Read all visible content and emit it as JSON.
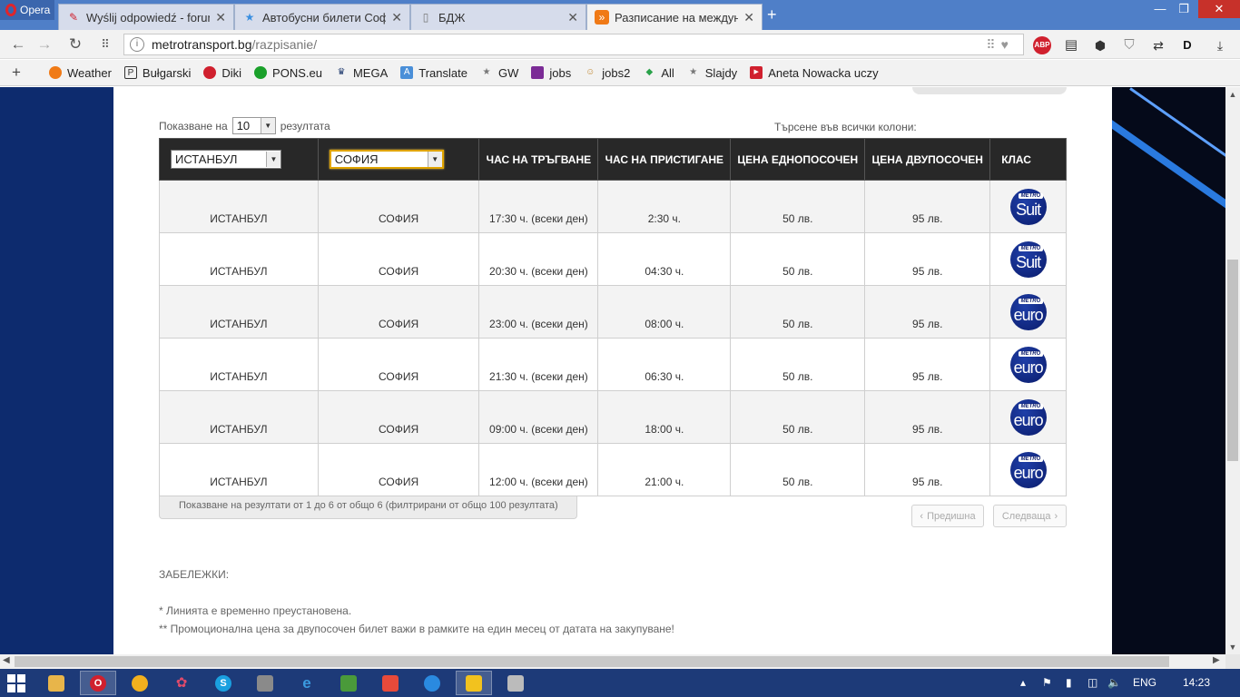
{
  "browser": {
    "app_name": "Opera",
    "tabs": [
      {
        "title": "Wyślij odpowiedź - forum",
        "icon": "pen-icon",
        "active": false
      },
      {
        "title": "Автобусни билети Софи",
        "icon": "star-badge-icon",
        "active": false
      },
      {
        "title": "БДЖ",
        "icon": "document-icon",
        "active": false
      },
      {
        "title": "Разписание на междунар",
        "icon": "orange-site-icon",
        "active": true
      }
    ],
    "new_tab": "+",
    "url_host": "metrotransport.bg",
    "url_path": "/razpisanie/",
    "extensions": {
      "adblock": "ABP"
    }
  },
  "bookmarks": [
    {
      "label": "Weather",
      "icon": "weather-icon",
      "color": "#f07a16"
    },
    {
      "label": "Bułgarski",
      "icon": "ip-icon",
      "color": "#333333"
    },
    {
      "label": "Diki",
      "icon": "diki-icon",
      "color": "#d0202e"
    },
    {
      "label": "PONS.eu",
      "icon": "pons-icon",
      "color": "#1aa02a"
    },
    {
      "label": "MEGA",
      "icon": "crown-icon",
      "color": "#1f3a6e"
    },
    {
      "label": "Translate",
      "icon": "translate-icon",
      "color": "#4a8fd8"
    },
    {
      "label": "GW",
      "icon": "star-icon",
      "color": "#777777"
    },
    {
      "label": "jobs",
      "icon": "square-icon",
      "color": "#7b2c96"
    },
    {
      "label": "jobs2",
      "icon": "jobs2-icon",
      "color": "#c0862e"
    },
    {
      "label": "All",
      "icon": "diamond-icon",
      "color": "#2aa24a"
    },
    {
      "label": "Slajdy",
      "icon": "star-icon",
      "color": "#777777"
    },
    {
      "label": "Aneta Nowacka uczy",
      "icon": "youtube-icon",
      "color": "#d0202e"
    }
  ],
  "table_controls": {
    "show_prefix": "Показване на",
    "page_length": "10",
    "show_suffix": "резултата",
    "search_label": "Търсене във всички колони:"
  },
  "table": {
    "filters": {
      "from": "ИСТАНБУЛ",
      "to": "СОФИЯ"
    },
    "headers": {
      "departure": "ЧАС НА ТРЪГВАНЕ",
      "arrival": "ЧАС НА ПРИСТИГАНЕ",
      "price_one": "ЦЕНА ЕДНОПОСОЧЕН",
      "price_two": "ЦЕНА ДВУПОСОЧЕН",
      "class": "КЛАС"
    },
    "rows": [
      {
        "from": "ИСТАНБУЛ",
        "to": "СОФИЯ",
        "dep": "17:30 ч. (всеки ден)",
        "arr": "2:30 ч.",
        "one": "50 лв.",
        "two": "95 лв.",
        "class": "Suit",
        "class_brand": "METRO"
      },
      {
        "from": "ИСТАНБУЛ",
        "to": "СОФИЯ",
        "dep": "20:30 ч. (всеки ден)",
        "arr": "04:30 ч.",
        "one": "50 лв.",
        "two": "95 лв.",
        "class": "Suit",
        "class_brand": "METRO"
      },
      {
        "from": "ИСТАНБУЛ",
        "to": "СОФИЯ",
        "dep": "23:00 ч. (всеки ден)",
        "arr": "08:00 ч.",
        "one": "50 лв.",
        "two": "95 лв.",
        "class": "euro",
        "class_brand": "METRO"
      },
      {
        "from": "ИСТАНБУЛ",
        "to": "СОФИЯ",
        "dep": "21:30 ч. (всеки ден)",
        "arr": "06:30 ч.",
        "one": "50 лв.",
        "two": "95 лв.",
        "class": "euro",
        "class_brand": "METRO"
      },
      {
        "from": "ИСТАНБУЛ",
        "to": "СОФИЯ",
        "dep": "09:00 ч. (всеки ден)",
        "arr": "18:00 ч.",
        "one": "50 лв.",
        "two": "95 лв.",
        "class": "euro",
        "class_brand": "METRO"
      },
      {
        "from": "ИСТАНБУЛ",
        "to": "СОФИЯ",
        "dep": "12:00 ч. (всеки ден)",
        "arr": "21:00 ч.",
        "one": "50 лв.",
        "two": "95 лв.",
        "class": "euro",
        "class_brand": "METRO"
      }
    ]
  },
  "pagination": {
    "info": "Показване на резултати от 1 до 6 от общо 6 (филтрирани от общо 100 резултата)",
    "prev": "Предишна",
    "next": "Следваща"
  },
  "notes": {
    "title": "ЗАБЕЛЕЖКИ:",
    "items": [
      "* Линията е временно преустановена.",
      "** Промоционална цена за двупосочен билет важи в рамките на един месец от датата на закупуване!"
    ]
  },
  "taskbar": {
    "language": "ENG",
    "time": "14:23"
  },
  "colors": {
    "page_background": "#0d2b6e",
    "table_header": "#282828",
    "tab_strip": "#4f7fc8",
    "taskbar": "#1d3a78",
    "class_badge": "#0a1b6b"
  }
}
